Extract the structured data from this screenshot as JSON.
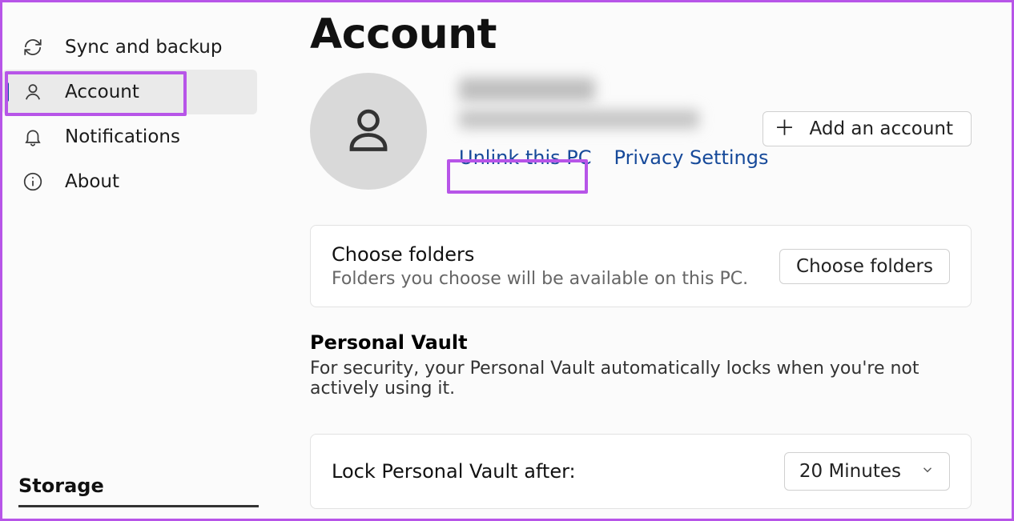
{
  "sidebar": {
    "items": [
      {
        "label": "Sync and backup"
      },
      {
        "label": "Account"
      },
      {
        "label": "Notifications"
      },
      {
        "label": "About"
      }
    ],
    "storage_label": "Storage"
  },
  "page": {
    "title": "Account"
  },
  "account": {
    "unlink_label": "Unlink this PC",
    "privacy_label": "Privacy Settings",
    "add_account_label": "Add an account"
  },
  "choose_folders": {
    "title": "Choose folders",
    "subtitle": "Folders you choose will be available on this PC.",
    "button": "Choose folders"
  },
  "personal_vault": {
    "title": "Personal Vault",
    "description": "For security, your Personal Vault automatically locks when you're not actively using it.",
    "lock_label": "Lock Personal Vault after:",
    "lock_value": "20 Minutes"
  }
}
